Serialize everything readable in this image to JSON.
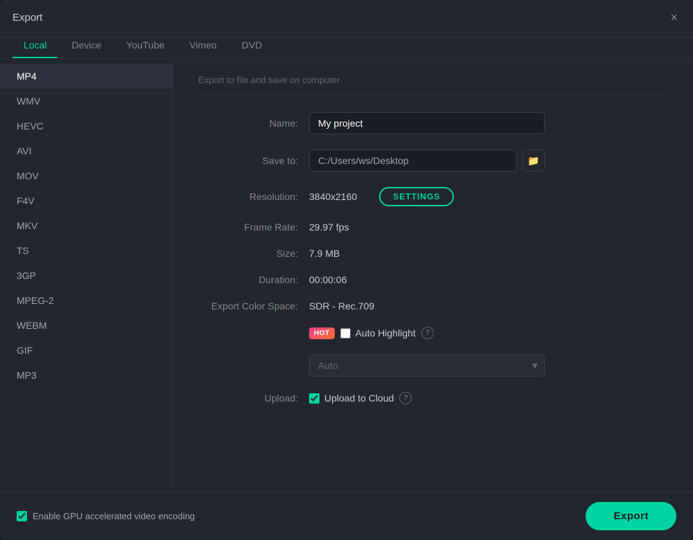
{
  "dialog": {
    "title": "Export",
    "close_label": "×"
  },
  "tabs": [
    {
      "id": "local",
      "label": "Local",
      "active": true
    },
    {
      "id": "device",
      "label": "Device",
      "active": false
    },
    {
      "id": "youtube",
      "label": "YouTube",
      "active": false
    },
    {
      "id": "vimeo",
      "label": "Vimeo",
      "active": false
    },
    {
      "id": "dvd",
      "label": "DVD",
      "active": false
    }
  ],
  "formats": [
    {
      "id": "mp4",
      "label": "MP4",
      "active": true
    },
    {
      "id": "wmv",
      "label": "WMV",
      "active": false
    },
    {
      "id": "hevc",
      "label": "HEVC",
      "active": false
    },
    {
      "id": "avi",
      "label": "AVI",
      "active": false
    },
    {
      "id": "mov",
      "label": "MOV",
      "active": false
    },
    {
      "id": "f4v",
      "label": "F4V",
      "active": false
    },
    {
      "id": "mkv",
      "label": "MKV",
      "active": false
    },
    {
      "id": "ts",
      "label": "TS",
      "active": false
    },
    {
      "id": "3gp",
      "label": "3GP",
      "active": false
    },
    {
      "id": "mpeg2",
      "label": "MPEG-2",
      "active": false
    },
    {
      "id": "webm",
      "label": "WEBM",
      "active": false
    },
    {
      "id": "gif",
      "label": "GIF",
      "active": false
    },
    {
      "id": "mp3",
      "label": "MP3",
      "active": false
    }
  ],
  "section_desc": "Export to file and save on computer",
  "fields": {
    "name_label": "Name:",
    "name_value": "My project",
    "save_to_label": "Save to:",
    "save_to_value": "C:/Users/ws/Desktop",
    "resolution_label": "Resolution:",
    "resolution_value": "3840x2160",
    "settings_label": "SETTINGS",
    "frame_rate_label": "Frame Rate:",
    "frame_rate_value": "29.97 fps",
    "size_label": "Size:",
    "size_value": "7.9 MB",
    "duration_label": "Duration:",
    "duration_value": "00:00:06",
    "color_space_label": "Export Color Space:",
    "color_space_value": "SDR - Rec.709",
    "hot_badge": "HOT",
    "auto_highlight_label": "Auto Highlight",
    "auto_dropdown_value": "Auto",
    "upload_label": "Upload:",
    "upload_to_cloud_label": "Upload to Cloud"
  },
  "footer": {
    "gpu_label": "Enable GPU accelerated video encoding",
    "export_label": "Export"
  },
  "icons": {
    "folder": "🗁",
    "chevron_down": "▾",
    "info": "?",
    "close": "✕"
  }
}
